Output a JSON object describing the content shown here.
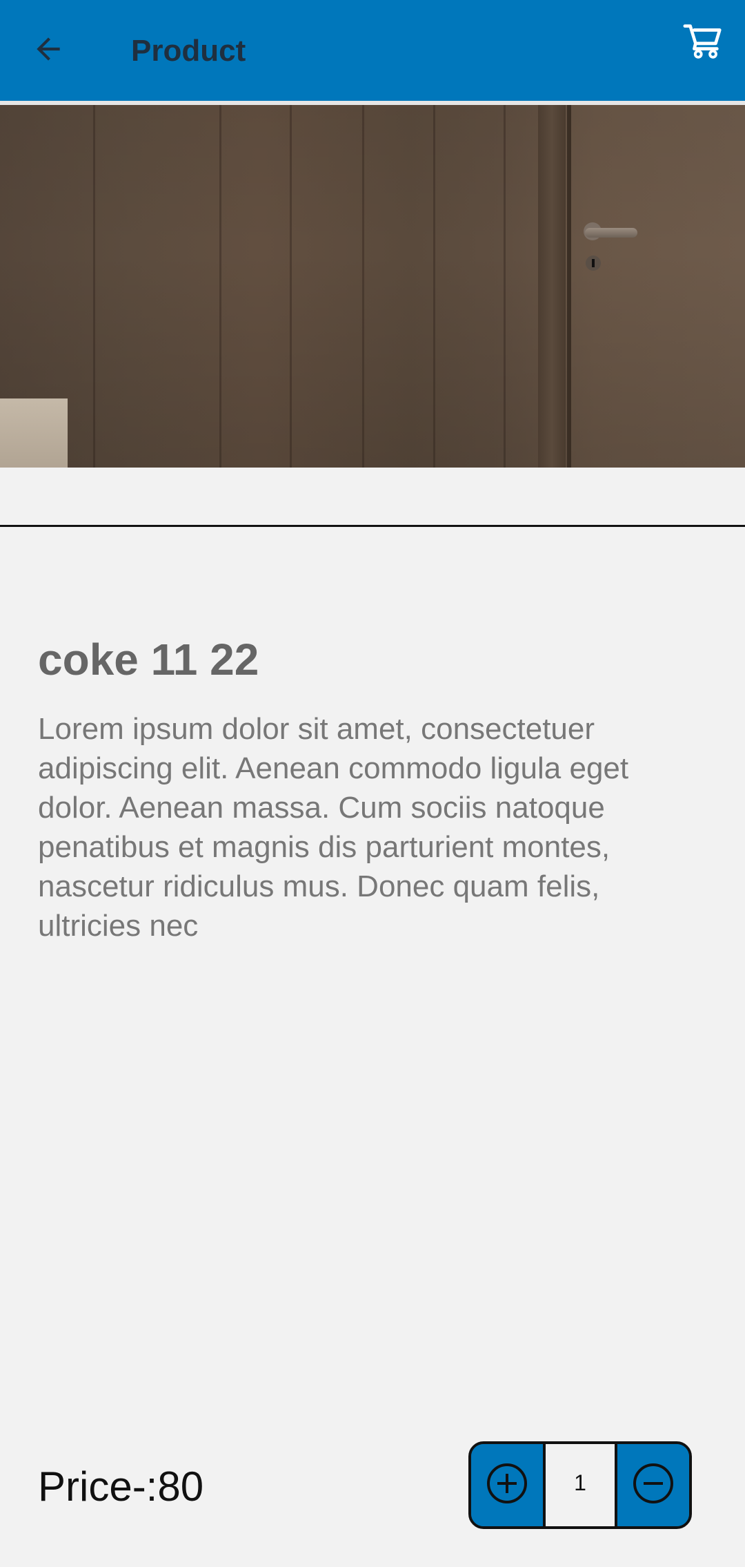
{
  "header": {
    "title": "Product",
    "back_icon": "arrow-left-icon",
    "cart_icon": "cart-icon",
    "background_color": "#0077bb"
  },
  "product": {
    "name": "coke 11 22",
    "description": "Lorem ipsum dolor sit amet, consectetuer adipiscing elit. Aenean commodo ligula eget dolor. Aenean massa. Cum sociis natoque penatibus et magnis dis parturient montes, nascetur ridiculus mus. Donec quam felis, ultricies nec",
    "price_label": "Price-:80"
  },
  "quantity": {
    "value": "1",
    "increase_icon": "plus-circle-icon",
    "decrease_icon": "minus-circle-icon"
  }
}
